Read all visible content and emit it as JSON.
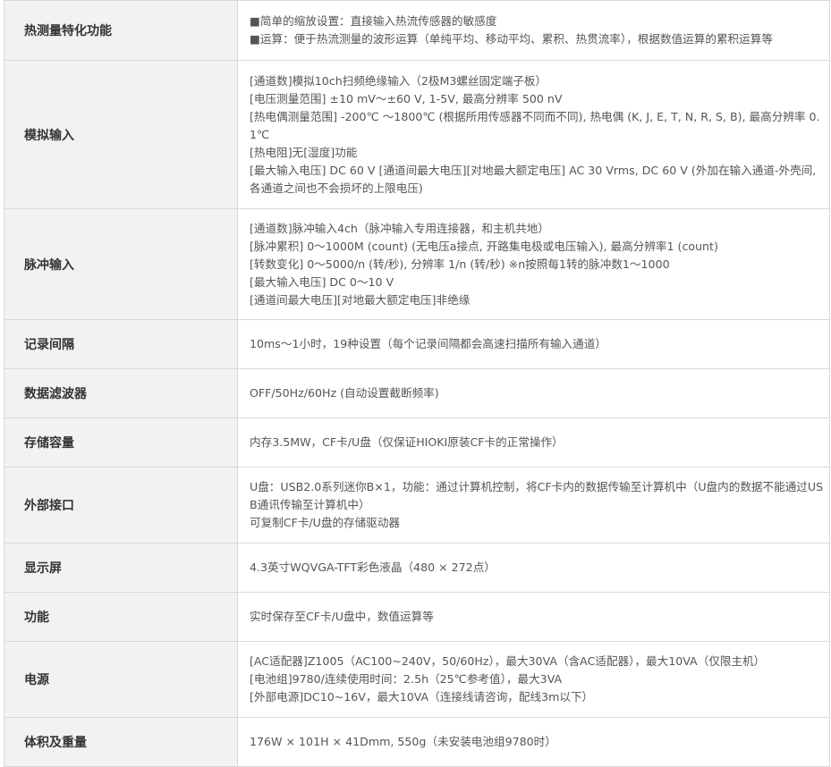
{
  "rows": [
    {
      "label": "热测量特化功能",
      "lines": [
        "■简单的缩放设置：直接输入热流传感器的敏感度",
        "■运算：便于热流测量的波形运算（单纯平均、移动平均、累积、热贯流率），根据数值运算的累积运算等"
      ]
    },
    {
      "label": "模拟输入",
      "lines": [
        "[通道数]模拟10ch扫频绝缘输入（2极M3螺丝固定端子板）",
        "[电压测量范围] ±10 mV～±60 V, 1-5V, 最高分辨率 500 nV",
        "[热电偶测量范围] -200℃ ～1800℃ (根据所用传感器不同而不同), 热电偶 (K, J, E, T, N, R, S, B), 最高分辨率 0.1℃",
        "[热电阻]无[湿度]功能",
        "[最大输入电压] DC 60 V [通道间最大电压][对地最大额定电压] AC 30 Vrms, DC 60 V (外加在输入通道-外壳间, 各通道之间也不会损坏的上限电压)"
      ]
    },
    {
      "label": "脉冲输入",
      "lines": [
        "[通道数]脉冲输入4ch（脉冲输入专用连接器，和主机共地）",
        "[脉冲累积] 0～1000M (count) (无电压a接点, 开路集电极或电压输入), 最高分辨率1 (count)",
        "[转数变化] 0～5000/n (转/秒), 分辨率 1/n (转/秒) ※n按照每1转的脉冲数1～1000",
        "[最大输入电压] DC 0～10 V",
        "[通道间最大电压][对地最大额定电压]非绝缘"
      ]
    },
    {
      "label": "记录间隔",
      "lines": [
        "10ms～1小时，19种设置（每个记录间隔都会高速扫描所有输入通道）"
      ]
    },
    {
      "label": "数据滤波器",
      "lines": [
        "OFF/50Hz/60Hz (自动设置截断频率)"
      ]
    },
    {
      "label": "存储容量",
      "lines": [
        "内存3.5MW，CF卡/U盘（仅保证HIOKI原装CF卡的正常操作）"
      ]
    },
    {
      "label": "外部接口",
      "lines": [
        "U盘：USB2.0系列迷你B×1，功能：通过计算机控制，将CF卡内的数据传输至计算机中（U盘内的数据不能通过USB通讯传输至计算机中）",
        "可复制CF卡/U盘的存储驱动器"
      ]
    },
    {
      "label": "显示屏",
      "lines": [
        "4.3英寸WQVGA-TFT彩色液晶（480 × 272点）"
      ]
    },
    {
      "label": "功能",
      "lines": [
        "实时保存至CF卡/U盘中，数值运算等"
      ]
    },
    {
      "label": "电源",
      "lines": [
        "[AC适配器]Z1005（AC100~240V，50/60Hz），最大30VA（含AC适配器），最大10VA（仅限主机）",
        "[电池组]9780/连续使用时间：2.5h（25℃参考值），最大3VA",
        "[外部电源]DC10~16V，最大10VA（连接线请咨询，配线3m以下）"
      ]
    },
    {
      "label": "体积及重量",
      "lines": [
        "176W × 101H × 41Dmm, 550g（未安装电池组9780时）"
      ]
    }
  ]
}
